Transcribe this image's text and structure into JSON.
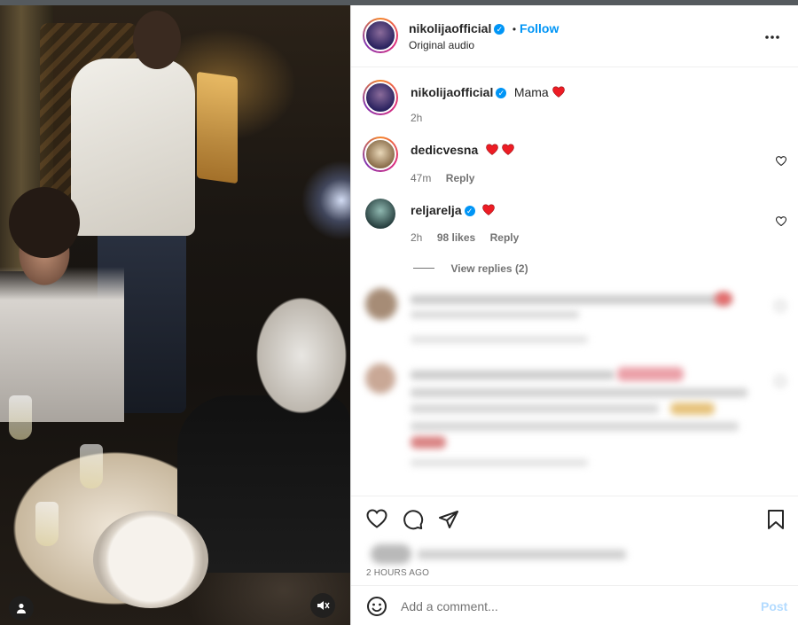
{
  "post": {
    "author": "nikolijaofficial",
    "follow_label": "Follow",
    "audio": "Original audio",
    "more_icon": "more-horizontal-icon",
    "caption": "Mama",
    "caption_time": "2h"
  },
  "comments": [
    {
      "user": "dedicvesna",
      "text": "",
      "time": "47m",
      "likes": "",
      "reply": "Reply",
      "verified": false
    },
    {
      "user": "reljarelja",
      "text": "",
      "time": "2h",
      "likes": "98 likes",
      "reply": "Reply",
      "verified": true
    }
  ],
  "view_replies": "View replies (2)",
  "timestamp": "2 HOURS AGO",
  "add_comment": {
    "placeholder": "Add a comment...",
    "post_label": "Post"
  },
  "colors": {
    "accent": "#0095f6",
    "heart": "#ed1c24",
    "text": "#262626",
    "muted": "#737373"
  },
  "icons": [
    "heart-icon",
    "comment-icon",
    "share-icon",
    "bookmark-icon",
    "emoji-icon",
    "mute-icon",
    "user-tag-icon"
  ]
}
